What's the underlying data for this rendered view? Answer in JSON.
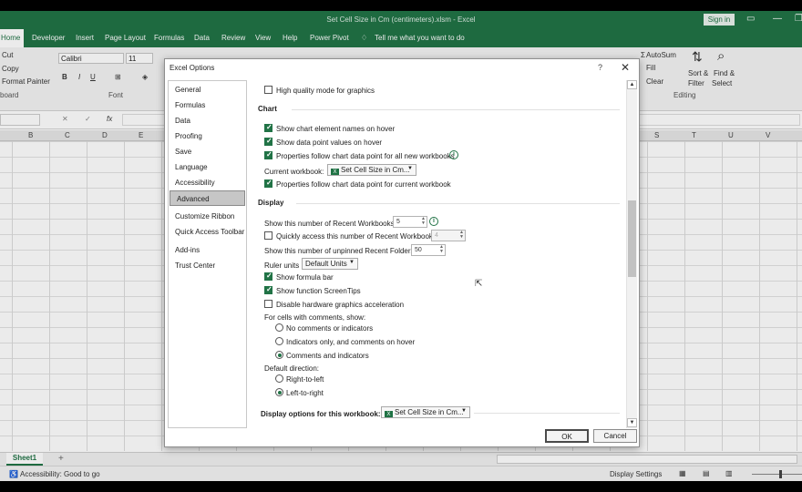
{
  "app": {
    "title": "Set Cell Size in Cm (centimeters).xlsm  -  Excel",
    "signin": "Sign in"
  },
  "ribbon": {
    "tabs": [
      "Home",
      "Developer",
      "Insert",
      "Page Layout",
      "Formulas",
      "Data",
      "Review",
      "View",
      "Help",
      "Power Pivot",
      "Tell me what you want to do"
    ],
    "clipboard": {
      "cut": "Cut",
      "copy": "Copy",
      "format_painter": "Format Painter",
      "group": "board"
    },
    "font": {
      "name": "Calibri",
      "size": "11",
      "group": "Font",
      "bold": "B",
      "italic": "I",
      "underline": "U"
    },
    "editing": {
      "autosum": "AutoSum",
      "fill": "Fill",
      "clear": "Clear",
      "sort": "Sort &",
      "sort2": "Filter",
      "find": "Find &",
      "find2": "Select",
      "group": "Editing"
    }
  },
  "formula": {
    "fx": "fx"
  },
  "columns": [
    "B",
    "C",
    "D",
    "E",
    "S",
    "T",
    "U",
    "V"
  ],
  "sheet": {
    "tab": "Sheet1",
    "add": "+"
  },
  "status": {
    "accessibility": "Accessibility: Good to go",
    "display_settings": "Display Settings"
  },
  "dialog": {
    "title": "Excel Options",
    "help": "?",
    "close": "✕",
    "nav": [
      "General",
      "Formulas",
      "Data",
      "Proofing",
      "Save",
      "Language",
      "Accessibility",
      "Advanced",
      "Customize Ribbon",
      "Quick Access Toolbar",
      "Add-ins",
      "Trust Center"
    ],
    "selected_nav": "Advanced",
    "hq_graphics": "High quality mode for graphics",
    "chart": {
      "heading": "Chart",
      "show_names": "Show chart element names on hover",
      "show_values": "Show data point values on hover",
      "props_all": "Properties follow chart data point for all new workbooks",
      "current_wb_label": "Current workbook:",
      "current_wb_value": "Set Cell Size in Cm...",
      "props_current": "Properties follow chart data point for current workbook"
    },
    "display": {
      "heading": "Display",
      "recent_wb_label": "Show this number of Recent Workbooks:",
      "recent_wb_value": "5",
      "quick_access_label": "Quickly access this number of Recent Workbooks:",
      "quick_access_value": "4",
      "unpinned_label": "Show this number of unpinned Recent Folders:",
      "unpinned_value": "50",
      "ruler_label": "Ruler units",
      "ruler_value": "Default Units",
      "formula_bar": "Show formula bar",
      "screentips": "Show function ScreenTips",
      "hw_accel": "Disable hardware graphics acceleration",
      "comments_label": "For cells with comments, show:",
      "comments_none": "No comments or indicators",
      "comments_ind": "Indicators only, and comments on hover",
      "comments_all": "Comments and indicators",
      "direction_label": "Default direction:",
      "rtl": "Right-to-left",
      "ltr": "Left-to-right"
    },
    "display_wb": {
      "heading": "Display options for this workbook:",
      "value": "Set Cell Size in Cm..."
    },
    "ok": "OK",
    "cancel": "Cancel"
  }
}
